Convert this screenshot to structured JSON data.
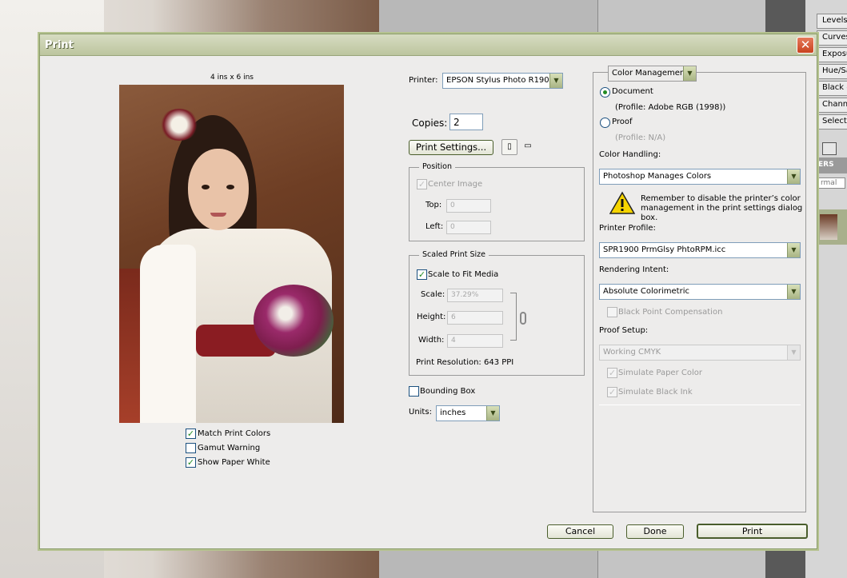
{
  "dialog": {
    "title": "Print"
  },
  "preview": {
    "size_label": "4 ins x 6 ins",
    "options": [
      {
        "label": "Match Print Colors",
        "checked": true
      },
      {
        "label": "Gamut Warning",
        "checked": false
      },
      {
        "label": "Show Paper White",
        "checked": true
      }
    ]
  },
  "printer": {
    "label": "Printer:",
    "value": "EPSON Stylus Photo R190..."
  },
  "copies": {
    "label": "Copies:",
    "value": "2"
  },
  "print_settings": {
    "label": "Print Settings..."
  },
  "position": {
    "title": "Position",
    "center_image": "Center Image",
    "top_label": "Top:",
    "top_value": "0",
    "left_label": "Left:",
    "left_value": "0"
  },
  "scaled": {
    "title": "Scaled Print Size",
    "scale_to_fit": "Scale to Fit Media",
    "scale_label": "Scale:",
    "scale_value": "37.29%",
    "height_label": "Height:",
    "height_value": "6",
    "width_label": "Width:",
    "width_value": "4",
    "resolution": "Print Resolution: 643 PPI"
  },
  "bounding_box": {
    "label": "Bounding Box",
    "checked": false
  },
  "units": {
    "label": "Units:",
    "value": "inches"
  },
  "color": {
    "mode": "Color Management",
    "document_label": "Document",
    "document_profile": "(Profile: Adobe RGB (1998))",
    "proof_label": "Proof",
    "proof_profile": "(Profile: N/A)",
    "handling_label": "Color Handling:",
    "handling_value": "Photoshop Manages Colors",
    "warning": "Remember to disable the printer’s color management in the print settings dialog box.",
    "profile_label": "Printer Profile:",
    "profile_value": "SPR1900 PrmGlsy PhtoRPM.icc",
    "intent_label": "Rendering Intent:",
    "intent_value": "Absolute Colorimetric",
    "bpc_label": "Black Point Compensation",
    "proof_setup_label": "Proof Setup:",
    "proof_setup_value": "Working CMYK",
    "sim_paper": "Simulate Paper Color",
    "sim_ink": "Simulate Black Ink"
  },
  "buttons": {
    "cancel": "Cancel",
    "done": "Done",
    "print": "Print"
  },
  "side_panel": {
    "adjustments": [
      "Levels",
      "Curves",
      "Exposu",
      "Hue/Sa",
      "Black &",
      "Chann",
      "Selectiv"
    ],
    "layers_tab": "ERS",
    "blend_mode": "rmal"
  }
}
